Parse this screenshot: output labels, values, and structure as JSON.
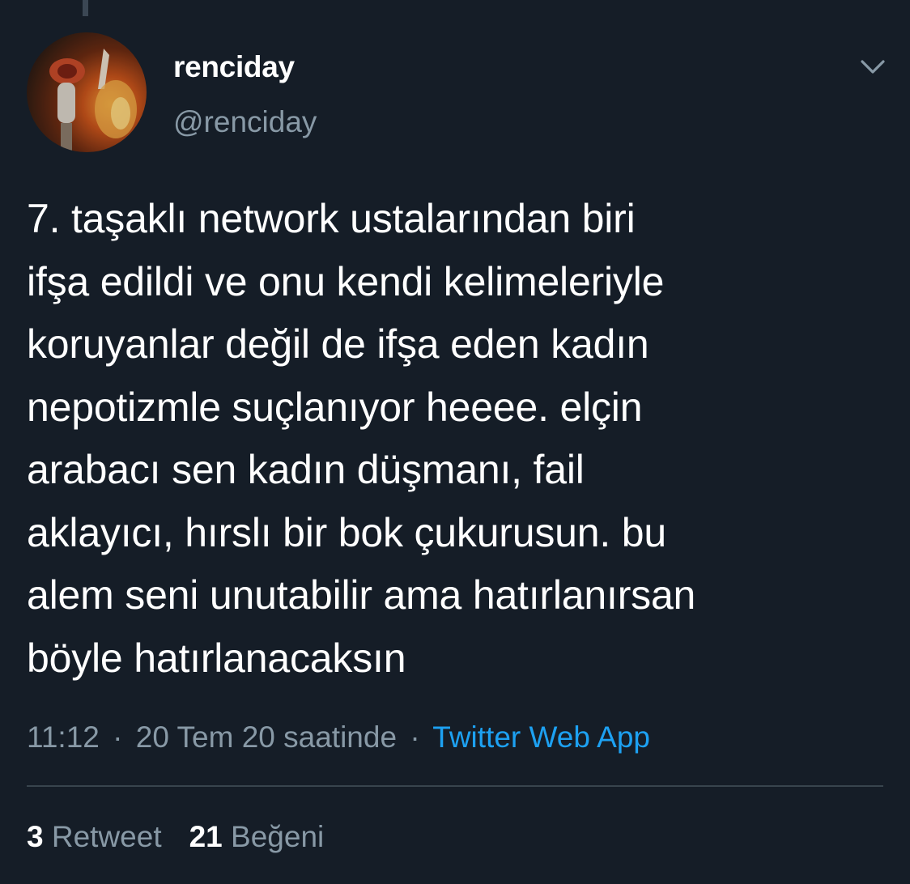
{
  "tweet": {
    "author": {
      "display_name": "renciday",
      "handle": "@renciday"
    },
    "text": "7. taşaklı network ustalarından biri\nifşa edildi ve onu kendi kelimeleriyle\nkoruyanlar değil de ifşa eden kadın\nnepotizmle suçlanıyor heeee. elçin\narabacı sen kadın düşmanı, fail\naklayıcı, hırslı bir bok çukurusun. bu\nalem seni unutabilir ama hatırlanırsan\nböyle hatırlanacaksın",
    "time": "11:12",
    "separator": "·",
    "date": "20 Tem 20 saatinde",
    "source": "Twitter Web App",
    "retweets": {
      "count": "3",
      "label": "Retweet"
    },
    "likes": {
      "count": "21",
      "label": "Beğeni"
    }
  },
  "colors": {
    "background": "#151d27",
    "text": "#ffffff",
    "secondary_text": "#8899a6",
    "link": "#1da1f2",
    "divider": "#38444d"
  },
  "icons": {
    "menu": "chevron-down-icon"
  }
}
